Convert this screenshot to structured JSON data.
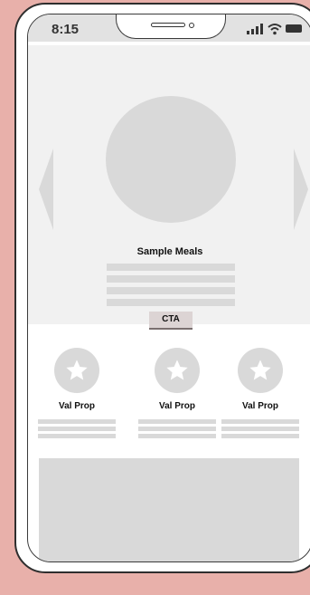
{
  "status_bar": {
    "time": "8:15",
    "icons": [
      "signal-icon",
      "wifi-icon",
      "battery-icon"
    ]
  },
  "hero": {
    "title": "Sample Meals",
    "cta_label": "CTA",
    "nav_icons": [
      "chevron-left-icon",
      "chevron-right-icon"
    ]
  },
  "value_props": [
    {
      "label": "Val Prop",
      "icon": "star-icon"
    },
    {
      "label": "Val Prop",
      "icon": "star-icon"
    },
    {
      "label": "Val Prop",
      "icon": "star-icon"
    }
  ],
  "colors": {
    "background": "#e8b0aa",
    "placeholder": "#d9d9d9",
    "hero_background": "#f1f1f1",
    "cta_background": "#dcd4d4"
  }
}
